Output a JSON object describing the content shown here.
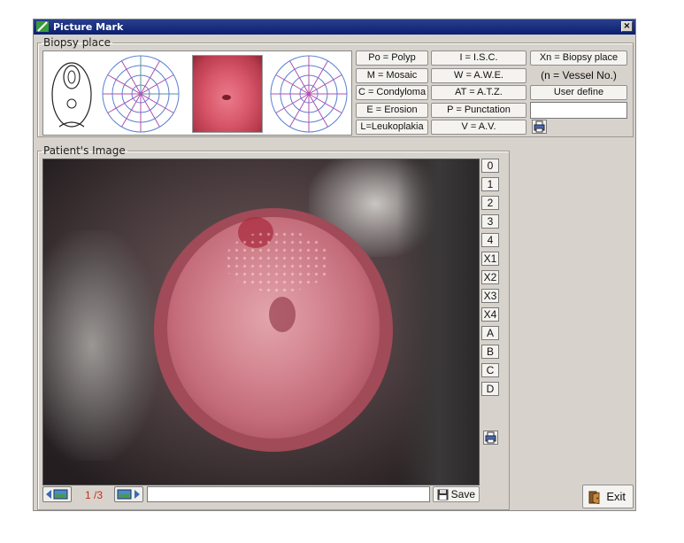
{
  "window": {
    "title": "Picture Mark",
    "close_label": "×"
  },
  "biopsy": {
    "legend": "Biopsy place",
    "buttons": [
      "Po = Polyp",
      "I = I.S.C.",
      "Xn = Biopsy place",
      "M = Mosaic",
      "W = A.W.E.",
      "C = Condyloma",
      "AT = A.T.Z.",
      "User define",
      "E = Erosion",
      "P = Punctation",
      "L=Leukoplakia",
      "V = A.V."
    ],
    "vessel_note": "(n = Vessel No.)",
    "user_define_value": ""
  },
  "patient": {
    "legend": "Patient's Image",
    "marker_buttons": [
      "0",
      "1",
      "2",
      "3",
      "4",
      "X1",
      "X2",
      "X3",
      "X4",
      "A",
      "B",
      "C",
      "D"
    ],
    "page_indicator": "1 /3",
    "comment_value": "",
    "save_label": "Save"
  },
  "footer": {
    "exit_label": "Exit"
  },
  "colors": {
    "title_bar": "#0a1f6e",
    "page_indicator": "#c03020",
    "background": "#d7d3cc"
  },
  "icons": [
    "app-logo-icon",
    "close-icon",
    "print-icon",
    "prev-image-icon",
    "next-image-icon",
    "save-disk-icon",
    "exit-door-icon"
  ]
}
